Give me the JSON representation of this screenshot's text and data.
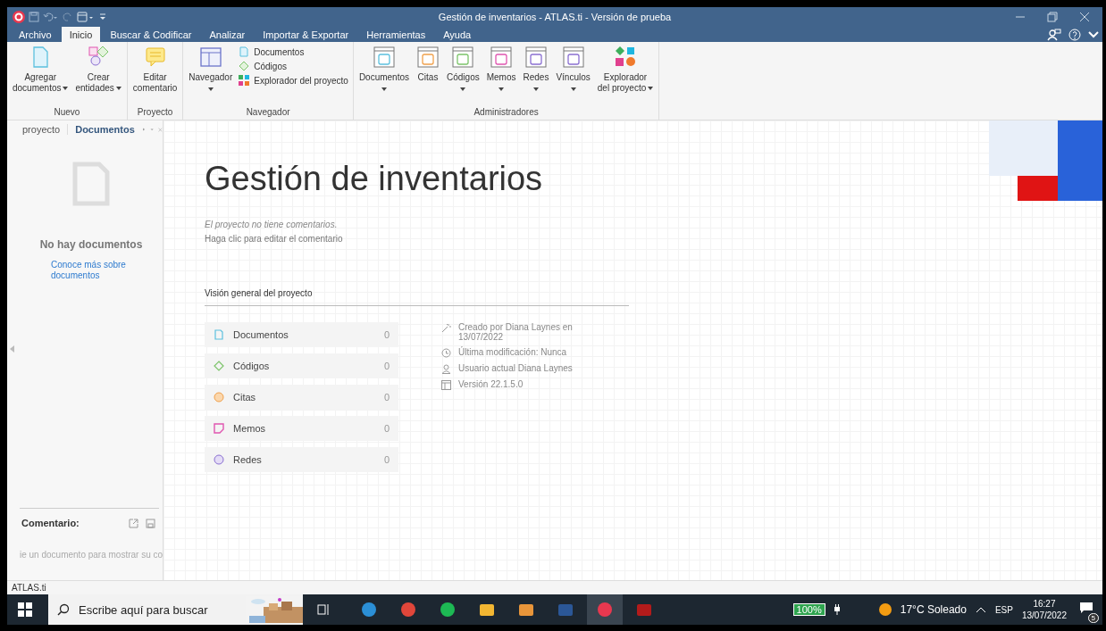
{
  "window": {
    "title": "Gestión de inventarios - ATLAS.ti - Versión de prueba"
  },
  "menu_tabs": [
    {
      "label": "Archivo",
      "selected": false
    },
    {
      "label": "Inicio",
      "selected": true
    },
    {
      "label": "Buscar & Codificar",
      "selected": false
    },
    {
      "label": "Analizar",
      "selected": false
    },
    {
      "label": "Importar & Exportar",
      "selected": false
    },
    {
      "label": "Herramientas",
      "selected": false
    },
    {
      "label": "Ayuda",
      "selected": false
    }
  ],
  "ribbon": {
    "groups": [
      {
        "label": "Nuevo",
        "items": [
          {
            "kind": "large",
            "lines": [
              "Agregar",
              "documentos"
            ],
            "dropdown": true
          },
          {
            "kind": "large",
            "lines": [
              "Crear",
              "entidades"
            ],
            "dropdown": true
          }
        ]
      },
      {
        "label": "Proyecto",
        "items": [
          {
            "kind": "large",
            "lines": [
              "Editar",
              "comentario"
            ],
            "dropdown": false
          }
        ]
      },
      {
        "label": "Navegador",
        "items": [
          {
            "kind": "large",
            "lines": [
              "Navegador"
            ],
            "dropdown": true
          },
          {
            "kind": "small",
            "lines": [
              "Documentos"
            ]
          },
          {
            "kind": "small",
            "lines": [
              "Códigos"
            ]
          },
          {
            "kind": "small",
            "lines": [
              "Explorador del proyecto"
            ]
          }
        ]
      },
      {
        "label": "Administradores",
        "items": [
          {
            "kind": "large",
            "lines": [
              "Documentos"
            ],
            "dropdown": true
          },
          {
            "kind": "large",
            "lines": [
              "Citas"
            ],
            "dropdown": false
          },
          {
            "kind": "large",
            "lines": [
              "Códigos"
            ],
            "dropdown": true
          },
          {
            "kind": "large",
            "lines": [
              "Memos"
            ],
            "dropdown": true
          },
          {
            "kind": "large",
            "lines": [
              "Redes"
            ],
            "dropdown": true
          },
          {
            "kind": "large",
            "lines": [
              "Vínculos"
            ],
            "dropdown": true
          },
          {
            "kind": "large",
            "lines": [
              "Explorador",
              "del proyecto"
            ],
            "dropdown": true
          }
        ]
      }
    ]
  },
  "side_panel": {
    "tabs": [
      {
        "label": "proyecto",
        "selected": false
      },
      {
        "label": "Documentos",
        "selected": true
      }
    ],
    "empty_title": "No hay documentos",
    "link": "Conoce más sobre documentos",
    "comment_label": "Comentario:",
    "comment_hint": "ie un documento para mostrar su co"
  },
  "main": {
    "title": "Gestión de inventarios",
    "comment": "El proyecto no tiene comentarios.",
    "edit_hint": "Haga clic para editar el comentario",
    "overview_heading": "Visión general del proyecto",
    "stats": [
      {
        "label": "Documentos",
        "count": "0"
      },
      {
        "label": "Códigos",
        "count": "0"
      },
      {
        "label": "Citas",
        "count": "0"
      },
      {
        "label": "Memos",
        "count": "0"
      },
      {
        "label": "Redes",
        "count": "0"
      }
    ],
    "info": [
      "Creado por Diana Laynes en 13/07/2022",
      "Última modificación: Nunca",
      "Usuario actual Diana Laynes",
      "Versión 22.1.5.0"
    ]
  },
  "status_bar": "ATLAS.ti",
  "taskbar": {
    "search_placeholder": "Escribe aquí para buscar",
    "apps": [
      {
        "selected": false
      },
      {
        "selected": false
      },
      {
        "selected": false
      },
      {
        "selected": false
      },
      {
        "selected": false
      },
      {
        "selected": false
      },
      {
        "selected": true
      },
      {
        "selected": false
      }
    ],
    "battery": "100%",
    "weather": "17°C Soleado",
    "language": "ESP",
    "time": "16:27",
    "date": "13/07/2022",
    "notifications": "5"
  }
}
